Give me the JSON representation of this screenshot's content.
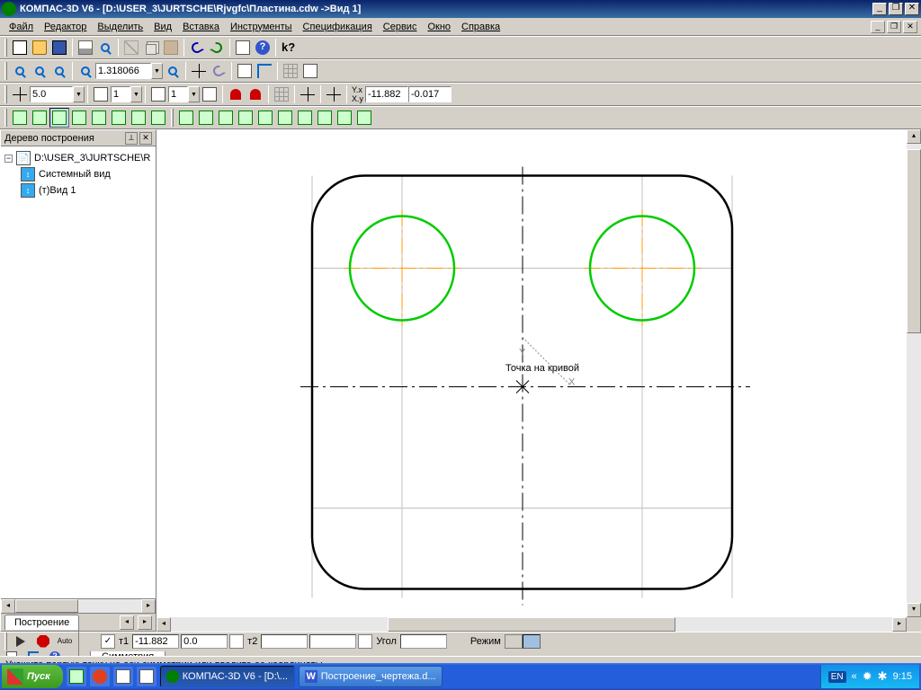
{
  "titlebar": {
    "text": "КОМПАС-3D V6 - [D:\\USER_3\\JURTSCHE\\Rjvgfc\\Пластина.cdw ->Вид 1]"
  },
  "menu": {
    "items": [
      "Файл",
      "Редактор",
      "Выделить",
      "Вид",
      "Вставка",
      "Инструменты",
      "Спецификация",
      "Сервис",
      "Окно",
      "Справка"
    ]
  },
  "toolbar3": {
    "zoom_value": "1.318066"
  },
  "toolbar4": {
    "step_value": "5.0",
    "layer_value": "1",
    "style_value": "1",
    "coord_x": "-11.882",
    "coord_y": "-0.017"
  },
  "tree": {
    "title": "Дерево построения",
    "root": "D:\\USER_3\\JURTSCHE\\R",
    "children": [
      "Системный вид",
      "(т)Вид 1"
    ],
    "tab": "Построение"
  },
  "canvas": {
    "tooltip": "Точка на кривой"
  },
  "propbar": {
    "t1_label": "т1",
    "t1_x": "-11.882",
    "t1_y": "0.0",
    "t2_label": "т2",
    "t2_x": "",
    "t2_y": "",
    "angle_label": "Угол",
    "angle": "",
    "mode_label": "Режим",
    "tab": "Симметрия"
  },
  "propbtns": {
    "auto": "Auto"
  },
  "statusbar": {
    "text": "Укажите первую точку на оси симметрии или введите ее координаты"
  },
  "taskbar": {
    "start": "Пуск",
    "tasks": [
      {
        "label": "КОМПАС-3D V6 - [D:\\...",
        "active": true
      },
      {
        "label": "Построение_чертежа.d...",
        "active": false
      }
    ],
    "lang": "EN",
    "time": "9:15"
  }
}
